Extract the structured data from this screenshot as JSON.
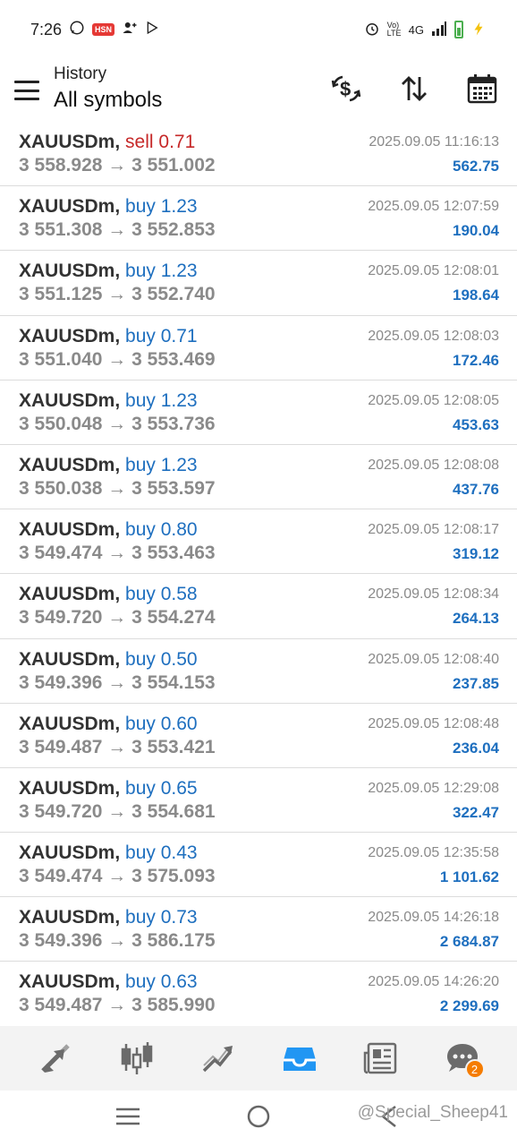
{
  "status_bar": {
    "time": "7:26",
    "app_badge": "HSN",
    "network": "4G",
    "volte": "Vo) LTE"
  },
  "header": {
    "subtitle": "History",
    "title": "All symbols"
  },
  "deals": [
    {
      "symbol": "XAUUSDm,",
      "type": "sell",
      "volume": "0.71",
      "open": "3 558.928",
      "close": "3 551.002",
      "time": "2025.09.05 11:16:13",
      "profit": "562.75"
    },
    {
      "symbol": "XAUUSDm,",
      "type": "buy",
      "volume": "1.23",
      "open": "3 551.308",
      "close": "3 552.853",
      "time": "2025.09.05 12:07:59",
      "profit": "190.04"
    },
    {
      "symbol": "XAUUSDm,",
      "type": "buy",
      "volume": "1.23",
      "open": "3 551.125",
      "close": "3 552.740",
      "time": "2025.09.05 12:08:01",
      "profit": "198.64"
    },
    {
      "symbol": "XAUUSDm,",
      "type": "buy",
      "volume": "0.71",
      "open": "3 551.040",
      "close": "3 553.469",
      "time": "2025.09.05 12:08:03",
      "profit": "172.46"
    },
    {
      "symbol": "XAUUSDm,",
      "type": "buy",
      "volume": "1.23",
      "open": "3 550.048",
      "close": "3 553.736",
      "time": "2025.09.05 12:08:05",
      "profit": "453.63"
    },
    {
      "symbol": "XAUUSDm,",
      "type": "buy",
      "volume": "1.23",
      "open": "3 550.038",
      "close": "3 553.597",
      "time": "2025.09.05 12:08:08",
      "profit": "437.76"
    },
    {
      "symbol": "XAUUSDm,",
      "type": "buy",
      "volume": "0.80",
      "open": "3 549.474",
      "close": "3 553.463",
      "time": "2025.09.05 12:08:17",
      "profit": "319.12"
    },
    {
      "symbol": "XAUUSDm,",
      "type": "buy",
      "volume": "0.58",
      "open": "3 549.720",
      "close": "3 554.274",
      "time": "2025.09.05 12:08:34",
      "profit": "264.13"
    },
    {
      "symbol": "XAUUSDm,",
      "type": "buy",
      "volume": "0.50",
      "open": "3 549.396",
      "close": "3 554.153",
      "time": "2025.09.05 12:08:40",
      "profit": "237.85"
    },
    {
      "symbol": "XAUUSDm,",
      "type": "buy",
      "volume": "0.60",
      "open": "3 549.487",
      "close": "3 553.421",
      "time": "2025.09.05 12:08:48",
      "profit": "236.04"
    },
    {
      "symbol": "XAUUSDm,",
      "type": "buy",
      "volume": "0.65",
      "open": "3 549.720",
      "close": "3 554.681",
      "time": "2025.09.05 12:29:08",
      "profit": "322.47"
    },
    {
      "symbol": "XAUUSDm,",
      "type": "buy",
      "volume": "0.43",
      "open": "3 549.474",
      "close": "3 575.093",
      "time": "2025.09.05 12:35:58",
      "profit": "1 101.62"
    },
    {
      "symbol": "XAUUSDm,",
      "type": "buy",
      "volume": "0.73",
      "open": "3 549.396",
      "close": "3 586.175",
      "time": "2025.09.05 14:26:18",
      "profit": "2 684.87"
    },
    {
      "symbol": "XAUUSDm,",
      "type": "buy",
      "volume": "0.63",
      "open": "3 549.487",
      "close": "3 585.990",
      "time": "2025.09.05 14:26:20",
      "profit": "2 299.69"
    }
  ],
  "price_arrow": "→",
  "bottom_nav": {
    "items": [
      {
        "name": "quotes",
        "icon": "quotes-arrows-icon"
      },
      {
        "name": "chart",
        "icon": "candlestick-icon"
      },
      {
        "name": "trade",
        "icon": "trade-trend-icon"
      },
      {
        "name": "history",
        "icon": "inbox-icon",
        "active": true
      },
      {
        "name": "news",
        "icon": "newspaper-icon"
      },
      {
        "name": "messages",
        "icon": "chat-icon",
        "badge": "2"
      }
    ],
    "active_color": "#2196f3",
    "icon_color": "#6b6b6b"
  },
  "watermark": "@Special_Sheep41",
  "colors": {
    "buy": "#1e6fbf",
    "sell": "#c62828",
    "profit": "#1e6fbf",
    "muted": "#8a8a8a"
  }
}
